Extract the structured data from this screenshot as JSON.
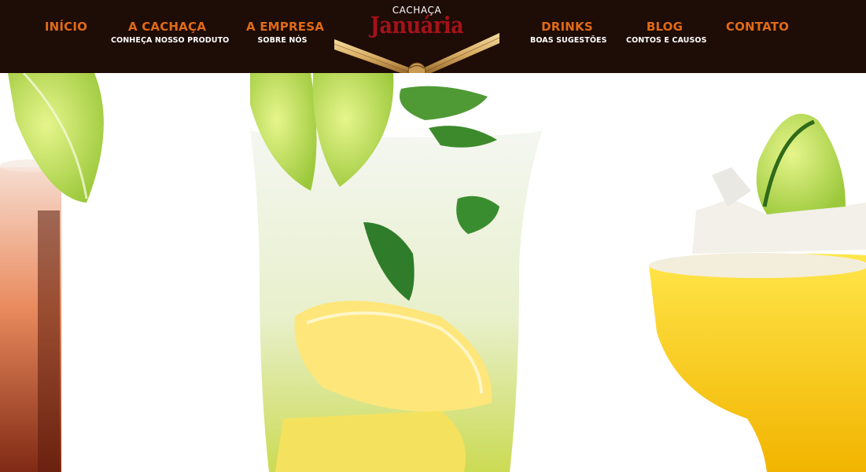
{
  "brand": {
    "small": "CACHAÇA",
    "name": "Januária"
  },
  "nav": {
    "inicio": {
      "label": "INÍCIO",
      "sub": ""
    },
    "cachaca": {
      "label": "A CACHAÇA",
      "sub": "CONHEÇA NOSSO PRODUTO"
    },
    "empresa": {
      "label": "A EMPRESA",
      "sub": "SOBRE NÓS"
    },
    "drinks": {
      "label": "DRINKS",
      "sub": "BOAS SUGESTÕES"
    },
    "blog": {
      "label": "BLOG",
      "sub": "CONTOS E CAUSOS"
    },
    "contato": {
      "label": "CONTATO",
      "sub": ""
    }
  },
  "colors": {
    "header_bg": "#1e0c06",
    "nav_accent": "#e06a16",
    "logo_red": "#a3121a"
  },
  "hero": {
    "image": "cocktail-drinks-photo"
  }
}
